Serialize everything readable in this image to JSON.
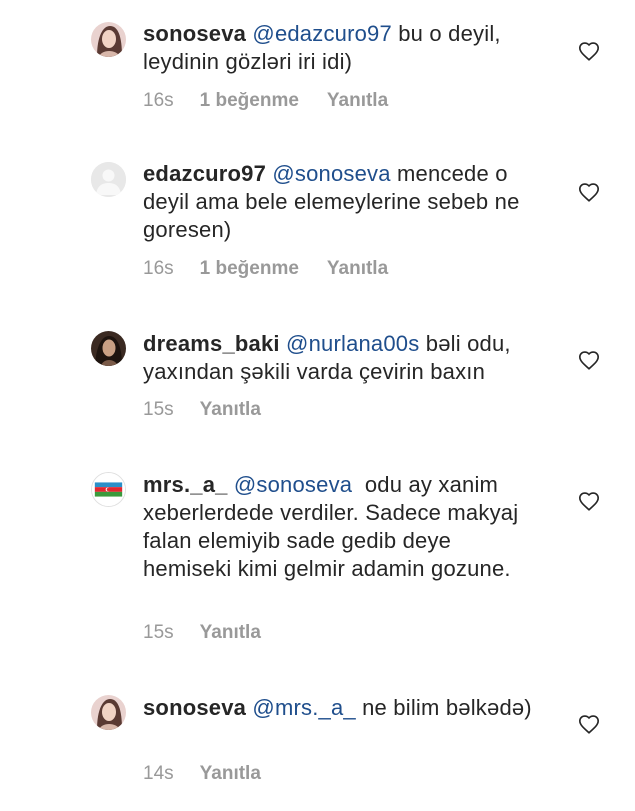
{
  "comments": [
    {
      "username": "sonoseva",
      "mention": "@edazcuro97",
      "text": " bu o deyil, leydinin gözləri iri idi)",
      "time": "16s",
      "likes": "1 beğenme",
      "reply": "Yanıtla",
      "avatar": "profile-photo-girl"
    },
    {
      "username": "edazcuro97",
      "mention": "@sonoseva",
      "text": " mencede o deyil ama bele elemeylerine sebeb ne goresen)",
      "time": "16s",
      "likes": "1 beğenme",
      "reply": "Yanıtla",
      "avatar": "default-avatar"
    },
    {
      "username": "dreams_baki",
      "mention": "@nurlana00s",
      "text": " bəli odu, yaxından şəkili varda çevirin baxın",
      "time": "15s",
      "likes": "",
      "reply": "Yanıtla",
      "avatar": "profile-photo-dark"
    },
    {
      "username": "mrs._a_",
      "mention": "@sonoseva",
      "text": "  odu ay xanim xeberlerdede verdiler. Sadece makyaj falan elemiyib sade gedib deye hemiseki kimi gelmir adamin gozune.",
      "time": "15s",
      "likes": "",
      "reply": "Yanıtla",
      "avatar": "azerbaijan-flag"
    },
    {
      "username": "sonoseva",
      "mention": "@mrs._a_",
      "text": " ne bilim bəlkədə)",
      "time": "14s",
      "likes": "",
      "reply": "Yanıtla",
      "avatar": "profile-photo-girl"
    }
  ],
  "colors": {
    "mention": "#1f4e8c",
    "meta": "#999999",
    "text": "#262626"
  }
}
